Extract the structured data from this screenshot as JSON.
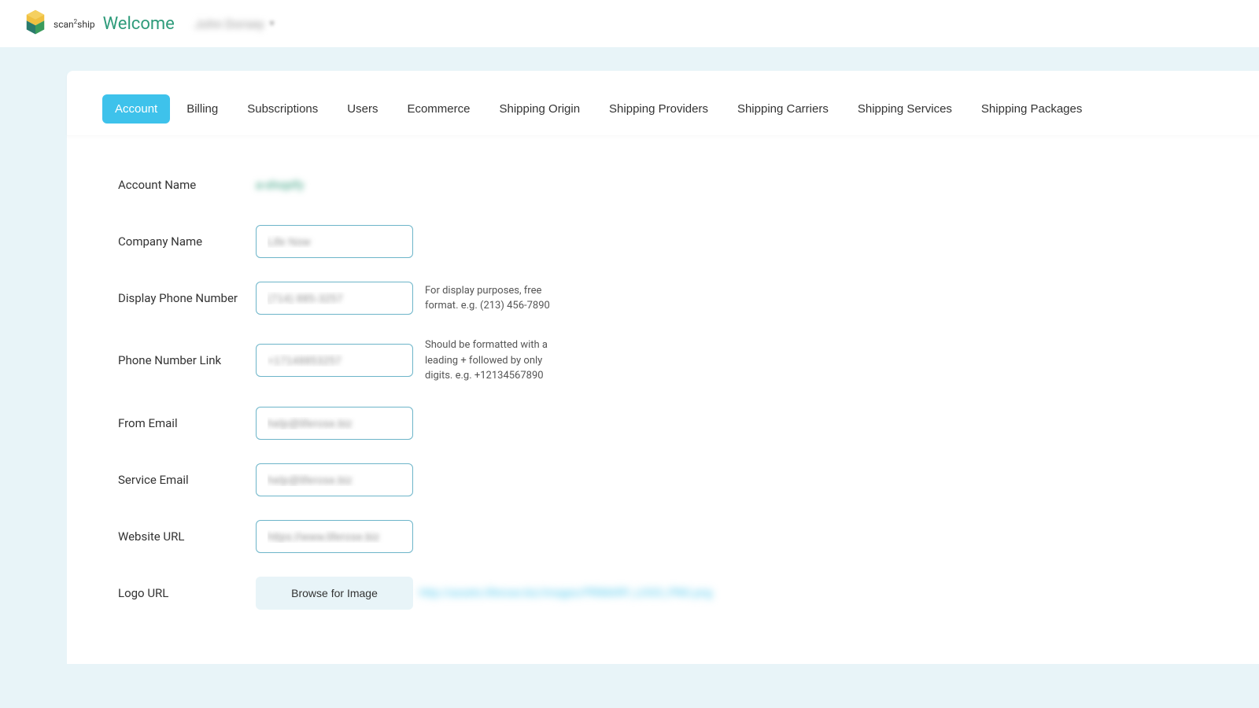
{
  "header": {
    "brand_scan": "scan",
    "brand_sup": "2",
    "brand_ship": "ship",
    "welcome": "Welcome",
    "user_name": "John Dorsey"
  },
  "tabs": [
    {
      "label": "Account",
      "active": true
    },
    {
      "label": "Billing",
      "active": false
    },
    {
      "label": "Subscriptions",
      "active": false
    },
    {
      "label": "Users",
      "active": false
    },
    {
      "label": "Ecommerce",
      "active": false
    },
    {
      "label": "Shipping Origin",
      "active": false
    },
    {
      "label": "Shipping Providers",
      "active": false
    },
    {
      "label": "Shipping Carriers",
      "active": false
    },
    {
      "label": "Shipping Services",
      "active": false
    },
    {
      "label": "Shipping Packages",
      "active": false
    }
  ],
  "form": {
    "account_name": {
      "label": "Account Name",
      "value": "a-shopify"
    },
    "company_name": {
      "label": "Company Name",
      "value": "Life Now"
    },
    "display_phone": {
      "label": "Display Phone Number",
      "value": "(714) 885-3257",
      "help": "For display purposes, free format. e.g. (213) 456-7890"
    },
    "phone_link": {
      "label": "Phone Number Link",
      "value": "+17148853257",
      "help": "Should be formatted with a leading + followed by only digits. e.g. +12134567890"
    },
    "from_email": {
      "label": "From Email",
      "value": "help@liferose.biz"
    },
    "service_email": {
      "label": "Service Email",
      "value": "help@liferose.biz"
    },
    "website_url": {
      "label": "Website URL",
      "value": "https://www.liferose.biz"
    },
    "logo_url": {
      "label": "Logo URL",
      "button": "Browse for Image",
      "value": "http://assets.liferose.biz/images/PRIMARY_LOGO_PNG.png"
    }
  }
}
